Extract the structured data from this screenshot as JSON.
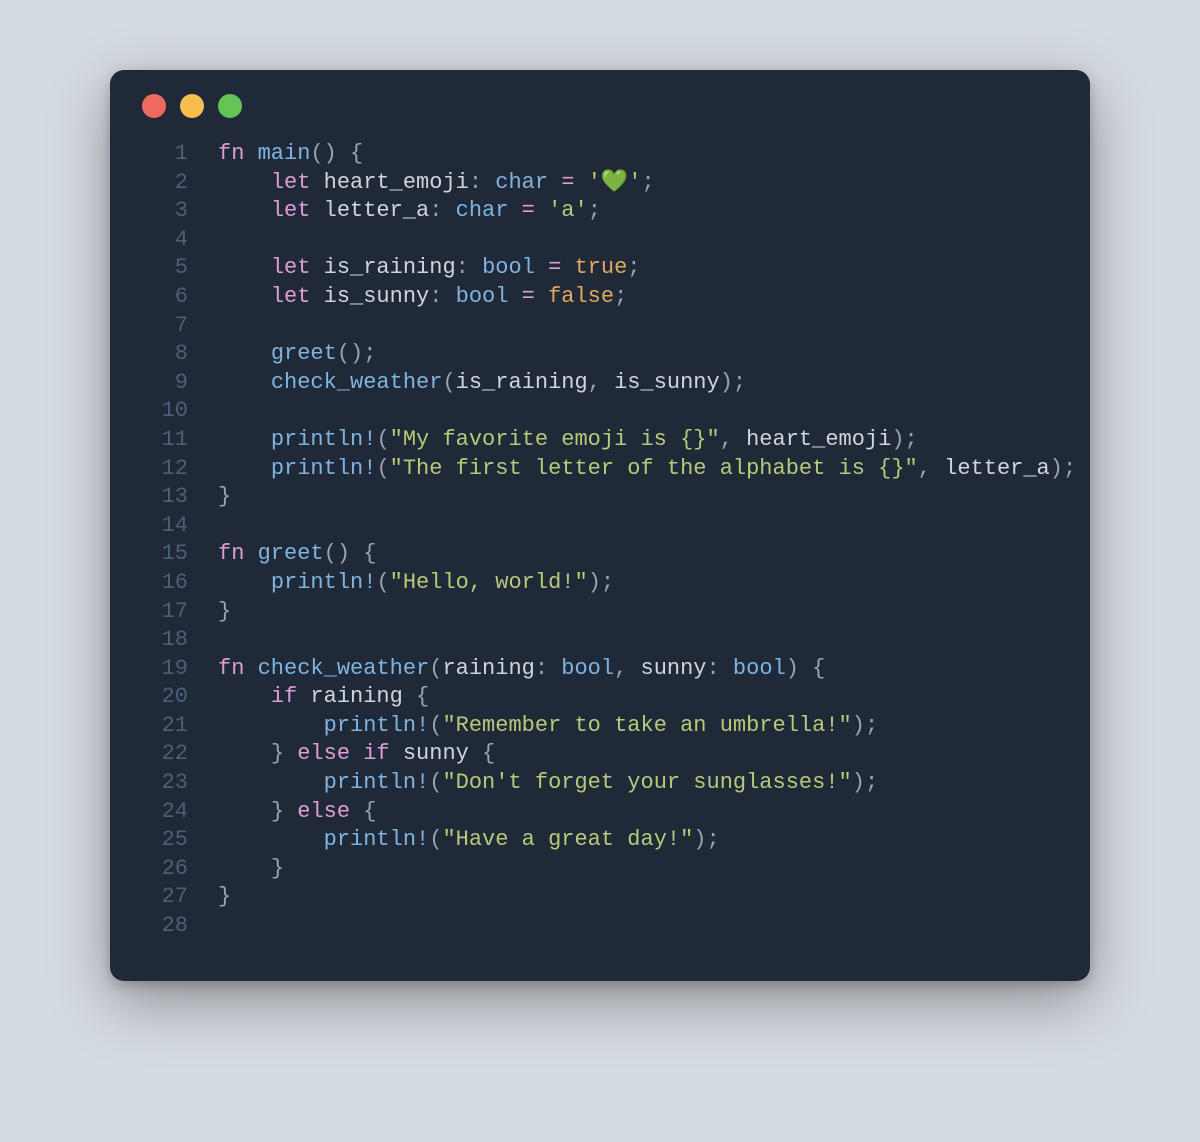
{
  "colors": {
    "background_page": "#d5dbe2",
    "background_window": "#1f2937",
    "dot_red": "#ee6a5f",
    "dot_yellow": "#f5be4f",
    "dot_green": "#62c554",
    "lineno": "#4b6078",
    "text": "#d1d5db",
    "keyword": "#de9dd6",
    "identifier": "#7fb4e0",
    "string": "#b6ca7a",
    "boolean": "#e2a95c",
    "punct": "#9ca3af"
  },
  "lines": [
    {
      "n": "1",
      "tokens": [
        {
          "t": "fn ",
          "c": "kw"
        },
        {
          "t": "main",
          "c": "fnname"
        },
        {
          "t": "()",
          "c": "punct"
        },
        {
          "t": " {",
          "c": "punct"
        }
      ]
    },
    {
      "n": "2",
      "tokens": [
        {
          "t": "    ",
          "c": "var"
        },
        {
          "t": "let ",
          "c": "kw"
        },
        {
          "t": "heart_emoji",
          "c": "var"
        },
        {
          "t": ": ",
          "c": "punct"
        },
        {
          "t": "char",
          "c": "type"
        },
        {
          "t": " ",
          "c": "var"
        },
        {
          "t": "=",
          "c": "op"
        },
        {
          "t": " ",
          "c": "var"
        },
        {
          "t": "'",
          "c": "chval"
        },
        {
          "t": "💚",
          "c": "heart"
        },
        {
          "t": "'",
          "c": "chval"
        },
        {
          "t": ";",
          "c": "punct"
        }
      ]
    },
    {
      "n": "3",
      "tokens": [
        {
          "t": "    ",
          "c": "var"
        },
        {
          "t": "let ",
          "c": "kw"
        },
        {
          "t": "letter_a",
          "c": "var"
        },
        {
          "t": ": ",
          "c": "punct"
        },
        {
          "t": "char",
          "c": "type"
        },
        {
          "t": " ",
          "c": "var"
        },
        {
          "t": "=",
          "c": "op"
        },
        {
          "t": " ",
          "c": "var"
        },
        {
          "t": "'a'",
          "c": "chval"
        },
        {
          "t": ";",
          "c": "punct"
        }
      ]
    },
    {
      "n": "4",
      "tokens": []
    },
    {
      "n": "5",
      "tokens": [
        {
          "t": "    ",
          "c": "var"
        },
        {
          "t": "let ",
          "c": "kw"
        },
        {
          "t": "is_raining",
          "c": "var"
        },
        {
          "t": ": ",
          "c": "punct"
        },
        {
          "t": "bool",
          "c": "type"
        },
        {
          "t": " ",
          "c": "var"
        },
        {
          "t": "=",
          "c": "op"
        },
        {
          "t": " ",
          "c": "var"
        },
        {
          "t": "true",
          "c": "bool"
        },
        {
          "t": ";",
          "c": "punct"
        }
      ]
    },
    {
      "n": "6",
      "tokens": [
        {
          "t": "    ",
          "c": "var"
        },
        {
          "t": "let ",
          "c": "kw"
        },
        {
          "t": "is_sunny",
          "c": "var"
        },
        {
          "t": ": ",
          "c": "punct"
        },
        {
          "t": "bool",
          "c": "type"
        },
        {
          "t": " ",
          "c": "var"
        },
        {
          "t": "=",
          "c": "op"
        },
        {
          "t": " ",
          "c": "var"
        },
        {
          "t": "false",
          "c": "bool"
        },
        {
          "t": ";",
          "c": "punct"
        }
      ]
    },
    {
      "n": "7",
      "tokens": []
    },
    {
      "n": "8",
      "tokens": [
        {
          "t": "    ",
          "c": "var"
        },
        {
          "t": "greet",
          "c": "fnname"
        },
        {
          "t": "()",
          "c": "punct"
        },
        {
          "t": ";",
          "c": "punct"
        }
      ]
    },
    {
      "n": "9",
      "tokens": [
        {
          "t": "    ",
          "c": "var"
        },
        {
          "t": "check_weather",
          "c": "fnname"
        },
        {
          "t": "(",
          "c": "punct"
        },
        {
          "t": "is_raining",
          "c": "var"
        },
        {
          "t": ", ",
          "c": "punct"
        },
        {
          "t": "is_sunny",
          "c": "var"
        },
        {
          "t": ")",
          "c": "punct"
        },
        {
          "t": ";",
          "c": "punct"
        }
      ]
    },
    {
      "n": "10",
      "tokens": []
    },
    {
      "n": "11",
      "tokens": [
        {
          "t": "    ",
          "c": "var"
        },
        {
          "t": "println!",
          "c": "builtin"
        },
        {
          "t": "(",
          "c": "punct"
        },
        {
          "t": "\"My favorite emoji is {}\"",
          "c": "str"
        },
        {
          "t": ", ",
          "c": "punct"
        },
        {
          "t": "heart_emoji",
          "c": "var"
        },
        {
          "t": ")",
          "c": "punct"
        },
        {
          "t": ";",
          "c": "punct"
        }
      ]
    },
    {
      "n": "12",
      "tokens": [
        {
          "t": "    ",
          "c": "var"
        },
        {
          "t": "println!",
          "c": "builtin"
        },
        {
          "t": "(",
          "c": "punct"
        },
        {
          "t": "\"The first letter of the alphabet is {}\"",
          "c": "str"
        },
        {
          "t": ", ",
          "c": "punct"
        },
        {
          "t": "letter_a",
          "c": "var"
        },
        {
          "t": ")",
          "c": "punct"
        },
        {
          "t": ";",
          "c": "punct"
        }
      ]
    },
    {
      "n": "13",
      "tokens": [
        {
          "t": "}",
          "c": "punct"
        }
      ]
    },
    {
      "n": "14",
      "tokens": []
    },
    {
      "n": "15",
      "tokens": [
        {
          "t": "fn ",
          "c": "kw"
        },
        {
          "t": "greet",
          "c": "fnname"
        },
        {
          "t": "()",
          "c": "punct"
        },
        {
          "t": " {",
          "c": "punct"
        }
      ]
    },
    {
      "n": "16",
      "tokens": [
        {
          "t": "    ",
          "c": "var"
        },
        {
          "t": "println!",
          "c": "builtin"
        },
        {
          "t": "(",
          "c": "punct"
        },
        {
          "t": "\"Hello, world!\"",
          "c": "str"
        },
        {
          "t": ")",
          "c": "punct"
        },
        {
          "t": ";",
          "c": "punct"
        }
      ]
    },
    {
      "n": "17",
      "tokens": [
        {
          "t": "}",
          "c": "punct"
        }
      ]
    },
    {
      "n": "18",
      "tokens": []
    },
    {
      "n": "19",
      "tokens": [
        {
          "t": "fn ",
          "c": "kw"
        },
        {
          "t": "check_weather",
          "c": "fnname"
        },
        {
          "t": "(",
          "c": "punct"
        },
        {
          "t": "raining",
          "c": "var"
        },
        {
          "t": ": ",
          "c": "punct"
        },
        {
          "t": "bool",
          "c": "type"
        },
        {
          "t": ", ",
          "c": "punct"
        },
        {
          "t": "sunny",
          "c": "var"
        },
        {
          "t": ": ",
          "c": "punct"
        },
        {
          "t": "bool",
          "c": "type"
        },
        {
          "t": ")",
          "c": "punct"
        },
        {
          "t": " {",
          "c": "punct"
        }
      ]
    },
    {
      "n": "20",
      "tokens": [
        {
          "t": "    ",
          "c": "var"
        },
        {
          "t": "if ",
          "c": "kw"
        },
        {
          "t": "raining",
          "c": "var"
        },
        {
          "t": " {",
          "c": "punct"
        }
      ]
    },
    {
      "n": "21",
      "tokens": [
        {
          "t": "        ",
          "c": "var"
        },
        {
          "t": "println!",
          "c": "builtin"
        },
        {
          "t": "(",
          "c": "punct"
        },
        {
          "t": "\"Remember to take an umbrella!\"",
          "c": "str"
        },
        {
          "t": ")",
          "c": "punct"
        },
        {
          "t": ";",
          "c": "punct"
        }
      ]
    },
    {
      "n": "22",
      "tokens": [
        {
          "t": "    ",
          "c": "var"
        },
        {
          "t": "}",
          "c": "punct"
        },
        {
          "t": " ",
          "c": "var"
        },
        {
          "t": "else if ",
          "c": "kw"
        },
        {
          "t": "sunny",
          "c": "var"
        },
        {
          "t": " {",
          "c": "punct"
        }
      ]
    },
    {
      "n": "23",
      "tokens": [
        {
          "t": "        ",
          "c": "var"
        },
        {
          "t": "println!",
          "c": "builtin"
        },
        {
          "t": "(",
          "c": "punct"
        },
        {
          "t": "\"Don't forget your sunglasses!\"",
          "c": "str"
        },
        {
          "t": ")",
          "c": "punct"
        },
        {
          "t": ";",
          "c": "punct"
        }
      ]
    },
    {
      "n": "24",
      "tokens": [
        {
          "t": "    ",
          "c": "var"
        },
        {
          "t": "}",
          "c": "punct"
        },
        {
          "t": " ",
          "c": "var"
        },
        {
          "t": "else ",
          "c": "kw"
        },
        {
          "t": "{",
          "c": "punct"
        }
      ]
    },
    {
      "n": "25",
      "tokens": [
        {
          "t": "        ",
          "c": "var"
        },
        {
          "t": "println!",
          "c": "builtin"
        },
        {
          "t": "(",
          "c": "punct"
        },
        {
          "t": "\"Have a great day!\"",
          "c": "str"
        },
        {
          "t": ")",
          "c": "punct"
        },
        {
          "t": ";",
          "c": "punct"
        }
      ]
    },
    {
      "n": "26",
      "tokens": [
        {
          "t": "    ",
          "c": "var"
        },
        {
          "t": "}",
          "c": "punct"
        }
      ]
    },
    {
      "n": "27",
      "tokens": [
        {
          "t": "}",
          "c": "punct"
        }
      ]
    },
    {
      "n": "28",
      "tokens": []
    }
  ]
}
